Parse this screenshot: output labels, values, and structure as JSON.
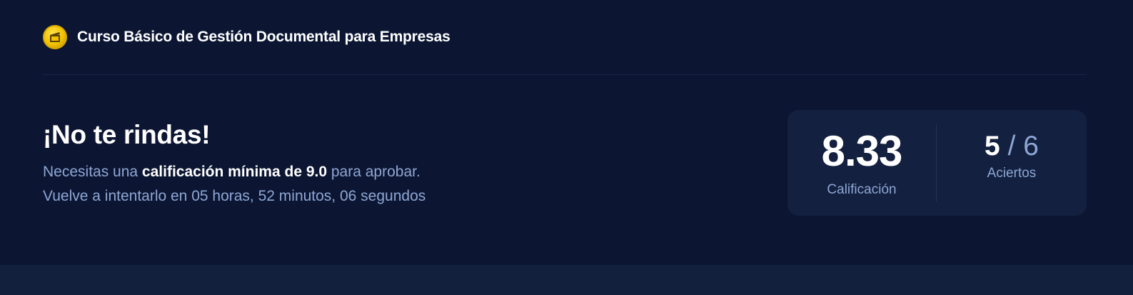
{
  "header": {
    "course_title": "Curso Básico de Gestión Documental para Empresas",
    "icon": "film-clapper-icon"
  },
  "result": {
    "heading": "¡No te rindas!",
    "requirement_prefix": "Necesitas una ",
    "requirement_bold": "calificación mínima de 9.0",
    "requirement_suffix": " para aprobar.",
    "retry_message": "Vuelve a intentarlo en 05 horas, 52 minutos, 06 segundos"
  },
  "score_card": {
    "score": "8.33",
    "score_label": "Calificación",
    "correct": "5",
    "separator": "/",
    "total": "6",
    "correct_label": "Aciertos"
  },
  "colors": {
    "background": "#0c1633",
    "card": "#13203f",
    "muted_text": "#8ea6d4",
    "icon_gold": "#f2c200"
  }
}
